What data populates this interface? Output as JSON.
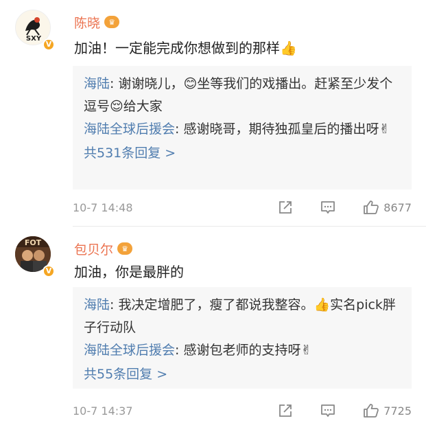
{
  "comments": [
    {
      "name": "陈晓",
      "avatar_text": "SXY",
      "text": "加油！一定能完成你想做到的那样👍",
      "replies": [
        {
          "name": "海陆",
          "text": "谢谢晓儿，😊坐等我们的戏播出。赶紧至少发个逗号😌给大家"
        },
        {
          "name": "海陆全球后援会",
          "text": "感谢晓哥，期待独孤皇后的播出呀✌"
        }
      ],
      "more": "共531条回复 >",
      "time": "10-7 14:48",
      "likes": "8677"
    },
    {
      "name": "包贝尔",
      "avatar_text": "FOT",
      "text": "加油，你是最胖的",
      "replies": [
        {
          "name": "海陆",
          "text": "我决定增肥了，瘦了都说我整容。👍实名pick胖子行动队"
        },
        {
          "name": "海陆全球后援会",
          "text": "感谢包老师的支持呀✌"
        }
      ],
      "more": "共55条回复 >",
      "time": "10-7 14:37",
      "likes": "7725"
    }
  ],
  "colors": {
    "name": "#eb7350",
    "link": "#507daf",
    "meta": "#999999",
    "reply_bg": "#f7f7f7"
  },
  "icons": {
    "verified": "verified-badge-icon",
    "crown": "crown-icon",
    "share": "share-icon",
    "comment": "comment-icon",
    "like": "thumbs-up-icon"
  }
}
